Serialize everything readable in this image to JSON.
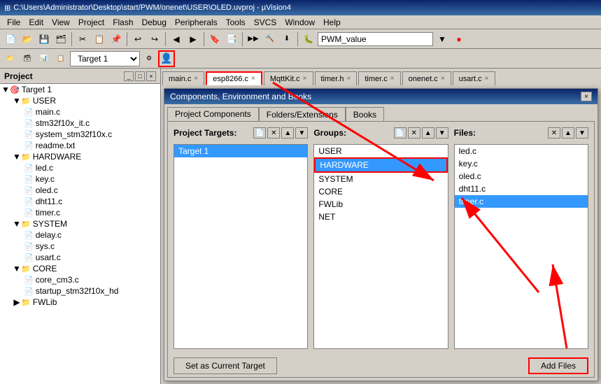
{
  "titlebar": {
    "text": "C:\\Users\\Administrator\\Desktop\\start/PWM/onenet\\USER\\OLED.uvproj - µVision4"
  },
  "menubar": {
    "items": [
      "File",
      "Edit",
      "View",
      "Project",
      "Flash",
      "Debug",
      "Peripherals",
      "Tools",
      "SVCS",
      "Window",
      "Help"
    ]
  },
  "toolbar": {
    "target_label": "Target 1",
    "pwm_value": "PWM_value"
  },
  "tabs": [
    {
      "label": "main.c",
      "active": false
    },
    {
      "label": "esp8266.c",
      "active": true
    },
    {
      "label": "MqttKit.c",
      "active": false
    },
    {
      "label": "timer.h",
      "active": false
    },
    {
      "label": "timer.c",
      "active": false
    },
    {
      "label": "onenet.c",
      "active": false
    },
    {
      "label": "usart.c",
      "active": false
    }
  ],
  "project_panel": {
    "title": "Project",
    "tree": [
      {
        "label": "Target 1",
        "level": 0,
        "type": "target",
        "expanded": true
      },
      {
        "label": "USER",
        "level": 1,
        "type": "folder",
        "expanded": true
      },
      {
        "label": "main.c",
        "level": 2,
        "type": "file"
      },
      {
        "label": "stm32f10x_it.c",
        "level": 2,
        "type": "file"
      },
      {
        "label": "system_stm32f10x.c",
        "level": 2,
        "type": "file"
      },
      {
        "label": "readme.txt",
        "level": 2,
        "type": "file"
      },
      {
        "label": "HARDWARE",
        "level": 1,
        "type": "folder",
        "expanded": true
      },
      {
        "label": "led.c",
        "level": 2,
        "type": "file"
      },
      {
        "label": "key.c",
        "level": 2,
        "type": "file"
      },
      {
        "label": "oled.c",
        "level": 2,
        "type": "file"
      },
      {
        "label": "dht11.c",
        "level": 2,
        "type": "file"
      },
      {
        "label": "timer.c",
        "level": 2,
        "type": "file"
      },
      {
        "label": "SYSTEM",
        "level": 1,
        "type": "folder",
        "expanded": true
      },
      {
        "label": "delay.c",
        "level": 2,
        "type": "file"
      },
      {
        "label": "sys.c",
        "level": 2,
        "type": "file"
      },
      {
        "label": "usart.c",
        "level": 2,
        "type": "file"
      },
      {
        "label": "CORE",
        "level": 1,
        "type": "folder",
        "expanded": true
      },
      {
        "label": "core_cm3.c",
        "level": 2,
        "type": "file"
      },
      {
        "label": "startup_stm32f10x_hd",
        "level": 2,
        "type": "file"
      },
      {
        "label": "FWLib",
        "level": 1,
        "type": "folder",
        "expanded": false
      }
    ]
  },
  "dialog": {
    "title": "Components, Environment and Books",
    "tabs": [
      "Project Components",
      "Folders/Extensions",
      "Books"
    ],
    "active_tab": "Project Components",
    "targets_label": "Project Targets:",
    "groups_label": "Groups:",
    "files_label": "Files:",
    "targets": [
      "Target 1"
    ],
    "groups": [
      "USER",
      "HARDWARE",
      "SYSTEM",
      "CORE",
      "FWLib",
      "NET"
    ],
    "files": [
      "led.c",
      "key.c",
      "oled.c",
      "dht11.c",
      "timer.c"
    ],
    "selected_target": "Target 1",
    "selected_group": "HARDWARE",
    "selected_file": "timer.c",
    "set_current_btn": "Set as Current Target",
    "add_files_btn": "Add Files"
  }
}
